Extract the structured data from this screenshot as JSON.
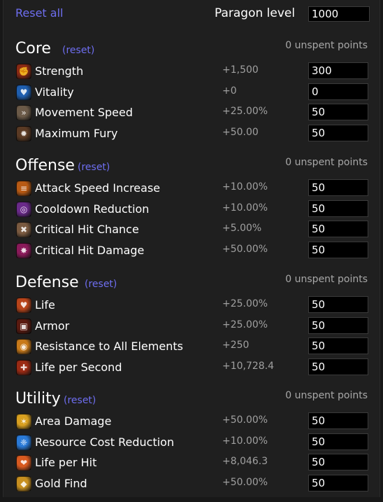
{
  "header": {
    "reset_all": "Reset all",
    "paragon_label": "Paragon level",
    "paragon_value": "1000"
  },
  "sections": [
    {
      "title": "Core",
      "reset": "(reset)",
      "unspent": "0 unspent points",
      "stats": [
        {
          "label": "Strength",
          "bonus": "+1,500",
          "value": "300",
          "icon": "strength-icon",
          "color": "#8a2a14"
        },
        {
          "label": "Vitality",
          "bonus": "+0",
          "value": "0",
          "icon": "vitality-icon",
          "color": "#1f5fb0"
        },
        {
          "label": "Movement Speed",
          "bonus": "+25.00%",
          "value": "50",
          "icon": "movement-speed-icon",
          "color": "#6b5a48"
        },
        {
          "label": "Maximum Fury",
          "bonus": "+50.00",
          "value": "50",
          "icon": "maximum-fury-icon",
          "color": "#5a3a24"
        }
      ]
    },
    {
      "title": "Offense",
      "reset": "(reset)",
      "unspent": "0 unspent points",
      "stats": [
        {
          "label": "Attack Speed Increase",
          "bonus": "+10.00%",
          "value": "50",
          "icon": "attack-speed-icon",
          "color": "#b85a14"
        },
        {
          "label": "Cooldown Reduction",
          "bonus": "+10.00%",
          "value": "50",
          "icon": "cooldown-reduction-icon",
          "color": "#6a2a8a"
        },
        {
          "label": "Critical Hit Chance",
          "bonus": "+5.00%",
          "value": "50",
          "icon": "critical-hit-chance-icon",
          "color": "#7a5a40"
        },
        {
          "label": "Critical Hit Damage",
          "bonus": "+50.00%",
          "value": "50",
          "icon": "critical-hit-damage-icon",
          "color": "#8a1a5a"
        }
      ]
    },
    {
      "title": "Defense",
      "reset": "(reset)",
      "unspent": "0 unspent points",
      "stats": [
        {
          "label": "Life",
          "bonus": "+25.00%",
          "value": "50",
          "icon": "life-icon",
          "color": "#b8441a"
        },
        {
          "label": "Armor",
          "bonus": "+25.00%",
          "value": "50",
          "icon": "armor-icon",
          "color": "#5a1a10"
        },
        {
          "label": "Resistance to All Elements",
          "bonus": "+250",
          "value": "50",
          "icon": "resistance-icon",
          "color": "#c87a1a"
        },
        {
          "label": "Life per Second",
          "bonus": "+10,728.4",
          "value": "50",
          "icon": "life-per-second-icon",
          "color": "#9a2a14"
        }
      ]
    },
    {
      "title": "Utility",
      "reset": "(reset)",
      "unspent": "0 unspent points",
      "stats": [
        {
          "label": "Area Damage",
          "bonus": "+50.00%",
          "value": "50",
          "icon": "area-damage-icon",
          "color": "#d8a020"
        },
        {
          "label": "Resource Cost Reduction",
          "bonus": "+10.00%",
          "value": "50",
          "icon": "resource-cost-reduction-icon",
          "color": "#2a7ad8"
        },
        {
          "label": "Life per Hit",
          "bonus": "+8,046.3",
          "value": "50",
          "icon": "life-per-hit-icon",
          "color": "#d85a20"
        },
        {
          "label": "Gold Find",
          "bonus": "+50.00%",
          "value": "50",
          "icon": "gold-find-icon",
          "color": "#c89020"
        }
      ]
    }
  ]
}
